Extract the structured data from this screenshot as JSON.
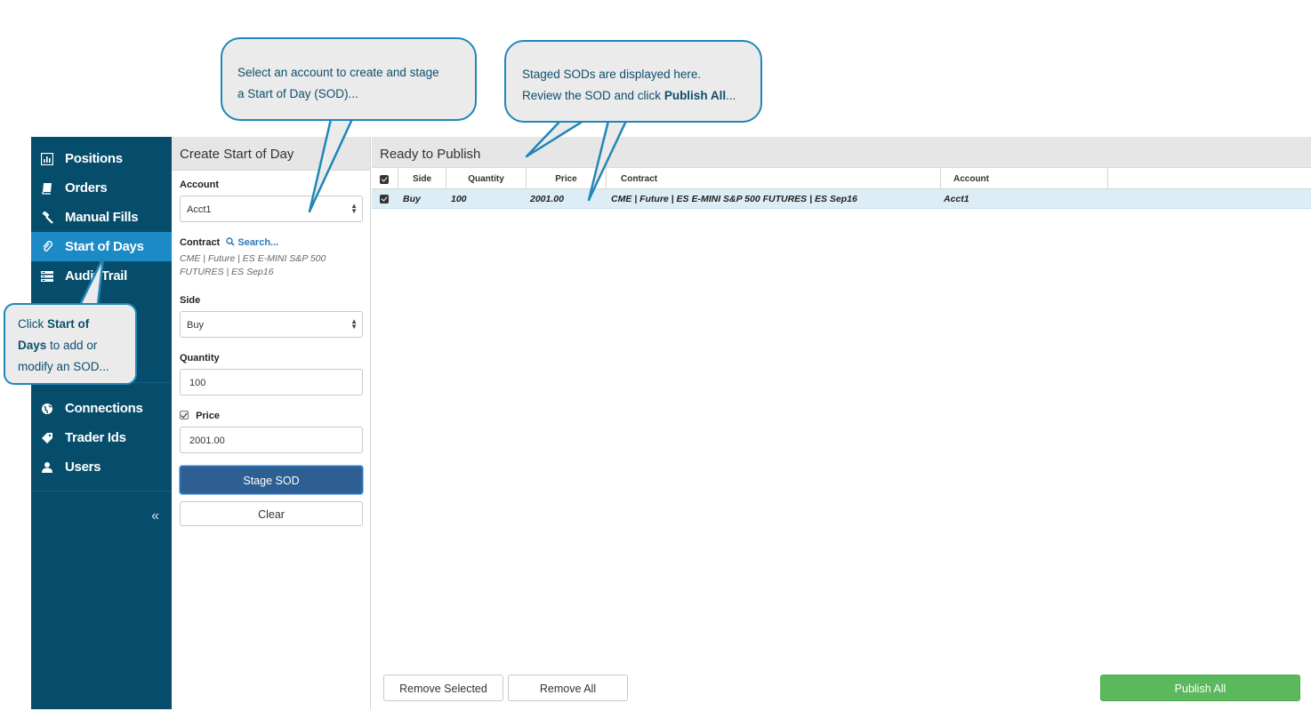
{
  "sidebar": {
    "items": [
      {
        "label": "Positions",
        "icon": "bar-chart-icon"
      },
      {
        "label": "Orders",
        "icon": "book-icon"
      },
      {
        "label": "Manual Fills",
        "icon": "gavel-icon"
      },
      {
        "label": "Start of Days",
        "icon": "paperclip-icon",
        "active": true
      },
      {
        "label": "Audit Trail",
        "icon": "list-icon"
      }
    ],
    "admin_items": [
      {
        "label": "Connections",
        "icon": "globe-icon"
      },
      {
        "label": "Trader Ids",
        "icon": "tag-icon"
      },
      {
        "label": "Users",
        "icon": "user-icon"
      }
    ],
    "collapse_glyph": "«"
  },
  "create_panel": {
    "title": "Create Start of Day",
    "account_label": "Account",
    "account_value": "Acct1",
    "contract_label": "Contract",
    "search_label": "Search...",
    "contract_value": "CME | Future | ES E-MINI S&P 500 FUTURES | ES Sep16",
    "side_label": "Side",
    "side_value": "Buy",
    "quantity_label": "Quantity",
    "quantity_value": "100",
    "price_label": "Price",
    "price_value": "2001.00",
    "stage_button": "Stage SOD",
    "clear_button": "Clear"
  },
  "publish_panel": {
    "title": "Ready to Publish",
    "columns": [
      "Side",
      "Quantity",
      "Price",
      "Contract",
      "Account"
    ],
    "rows": [
      {
        "side": "Buy",
        "quantity": "100",
        "price": "2001.00",
        "contract": "CME | Future | ES E-MINI S&P 500 FUTURES | ES Sep16",
        "account": "Acct1"
      }
    ],
    "remove_selected_button": "Remove Selected",
    "remove_all_button": "Remove All",
    "publish_all_button": "Publish All"
  },
  "callouts": {
    "account": {
      "line1": "Select an account to create and stage",
      "line2": "a Start of Day (SOD)..."
    },
    "staged": {
      "line1": "Staged SODs are displayed here.",
      "line2_prefix": "Review the SOD and click ",
      "line2_bold": "Publish All",
      "line2_suffix": "..."
    },
    "sidebar": {
      "line1_prefix": "Click ",
      "line1_bold": "Start of",
      "line2_bold": "Days",
      "line2_suffix": " to add or",
      "line3": "modify an SOD..."
    }
  },
  "colors": {
    "sidebar_bg": "#064d6b",
    "sidebar_active": "#1b8ac6",
    "stage_button": "#2e5f92",
    "publish_button": "#5cb85c",
    "callout_border": "#1f86b8",
    "row_highlight": "#dcedf6"
  }
}
